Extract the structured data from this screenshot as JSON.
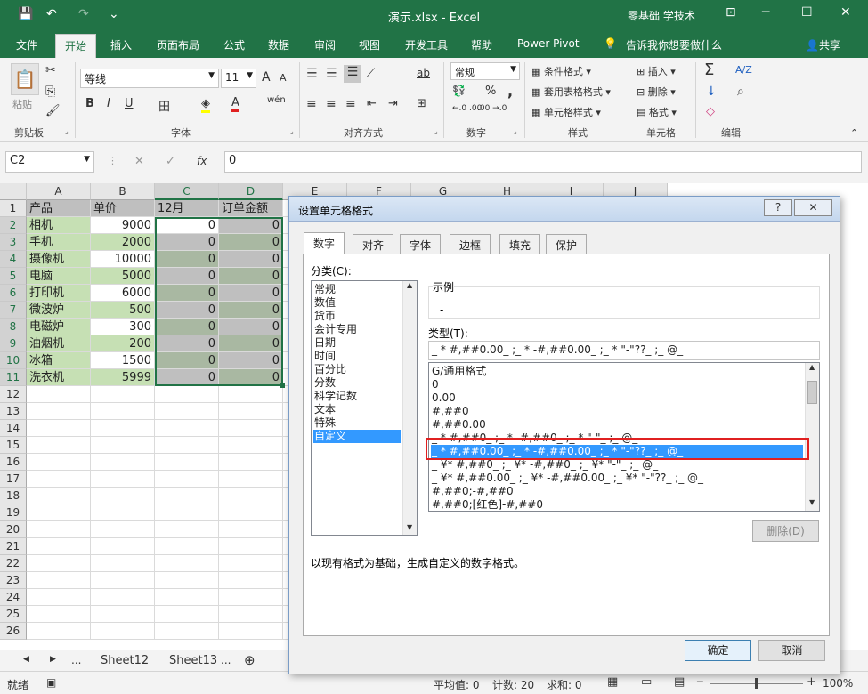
{
  "window": {
    "title": "演示.xlsx  -  Excel",
    "user": "零基础 学技术",
    "quick_access": {
      "save": "💾",
      "undo": "↶",
      "redo": "↷",
      "more": "⌄"
    },
    "controls": {
      "minimize": "─",
      "maximize": "☐",
      "close": "✕",
      "ribbon_options": "⊡"
    }
  },
  "menu": {
    "tabs": [
      "文件",
      "开始",
      "插入",
      "页面布局",
      "公式",
      "数据",
      "审阅",
      "视图",
      "开发工具",
      "帮助",
      "Power Pivot"
    ],
    "active_index": 1,
    "tell_me": "告诉我你想要做什么",
    "share": "共享"
  },
  "ribbon": {
    "clipboard": {
      "label": "剪贴板",
      "paste": "粘贴",
      "cut": "✂",
      "copy": "⎘",
      "brush": "🖌"
    },
    "font": {
      "label": "字体",
      "name": "等线",
      "size": "11",
      "grow": "A",
      "shrink": "A",
      "bold": "B",
      "italic": "I",
      "underline": "U",
      "border": "田",
      "fill": "◈",
      "color": "A",
      "phonetic": "wén"
    },
    "alignment": {
      "label": "对齐方式",
      "wrap": "ab",
      "orient": "⟋"
    },
    "number": {
      "label": "数字",
      "format": "常规",
      "currency": "💱",
      "percent": "%",
      "comma": ",",
      "inc": "←.0 .00",
      "dec": ".00 →.0"
    },
    "styles": {
      "label": "样式",
      "conditional": "条件格式",
      "table": "套用表格格式",
      "cell": "单元格样式"
    },
    "cells": {
      "label": "单元格",
      "insert": "插入",
      "delete": "删除",
      "format": "格式"
    },
    "editing": {
      "label": "编辑",
      "sum": "Σ",
      "sort": "A/Z",
      "fill": "↓",
      "find": "⌕",
      "clear": "◇"
    }
  },
  "formula_bar": {
    "name_box": "C2",
    "fx": "fx",
    "cancel": "✕",
    "confirm": "✓",
    "value": "0"
  },
  "sheet": {
    "columns": [
      "A",
      "B",
      "C",
      "D",
      "E",
      "F",
      "G",
      "H",
      "I",
      "J"
    ],
    "rows": [
      "1",
      "2",
      "3",
      "4",
      "5",
      "6",
      "7",
      "8",
      "9",
      "10",
      "11",
      "12",
      "13",
      "14",
      "15",
      "16",
      "17",
      "18",
      "19",
      "20",
      "21",
      "22",
      "23",
      "24",
      "25",
      "26"
    ],
    "header": [
      "产品",
      "单价",
      "12月",
      "订单金额"
    ],
    "data": [
      [
        "相机",
        "9000",
        "0",
        "0"
      ],
      [
        "手机",
        "2000",
        "0",
        "0"
      ],
      [
        "摄像机",
        "10000",
        "0",
        "0"
      ],
      [
        "电脑",
        "5000",
        "0",
        "0"
      ],
      [
        "打印机",
        "6000",
        "0",
        "0"
      ],
      [
        "微波炉",
        "500",
        "0",
        "0"
      ],
      [
        "电磁炉",
        "300",
        "0",
        "0"
      ],
      [
        "油烟机",
        "200",
        "0",
        "0"
      ],
      [
        "冰箱",
        "1500",
        "0",
        "0"
      ],
      [
        "洗衣机",
        "5999",
        "0",
        "0"
      ]
    ]
  },
  "sheet_tabs": {
    "items": [
      "...",
      "Sheet12",
      "Sheet13",
      "..."
    ],
    "add": "⊕",
    "nav_prev": "◀",
    "nav_next": "▶"
  },
  "status": {
    "ready": "就绪",
    "average": "平均值: 0",
    "count": "计数: 20",
    "sum": "求和: 0",
    "zoom": "100%",
    "zoom_out": "─",
    "zoom_in": "+"
  },
  "dialog": {
    "title": "设置单元格格式",
    "help": "?",
    "close": "✕",
    "tabs": [
      "数字",
      "对齐",
      "字体",
      "边框",
      "填充",
      "保护"
    ],
    "category_label": "分类(C):",
    "categories": [
      "常规",
      "数值",
      "货币",
      "会计专用",
      "日期",
      "时间",
      "百分比",
      "分数",
      "科学记数",
      "文本",
      "特殊",
      "自定义"
    ],
    "selected_category": "自定义",
    "sample_label": "示例",
    "sample_value": "-",
    "type_label": "类型(T):",
    "type_value": "_ * #,##0.00_ ;_ * -#,##0.00_ ;_ * \"-\"??_ ;_ @_",
    "formats": [
      "G/通用格式",
      "0",
      "0.00",
      "#,##0",
      "#,##0.00",
      "_ * #,##0_ ;_ * -#,##0_ ;_ * \"-\"_ ;_ @_",
      "_ * #,##0.00_ ;_ * -#,##0.00_ ;_ * \"-\"??_ ;_ @_",
      "_ ¥* #,##0_ ;_ ¥* -#,##0_ ;_ ¥* \"-\"_ ;_ @_",
      "_ ¥* #,##0.00_ ;_ ¥* -#,##0.00_ ;_ ¥* \"-\"??_ ;_ @_",
      "#,##0;-#,##0",
      "#,##0;[红色]-#,##0"
    ],
    "selected_format_index": 6,
    "delete_button": "删除(D)",
    "description": "以现有格式为基础，生成自定义的数字格式。",
    "ok": "确定",
    "cancel": "取消"
  },
  "colors": {
    "excel_green": "#217346",
    "selection_blue": "#3399ff",
    "highlight_red": "#e02020",
    "green_fill": "#c6e0b4",
    "grey_fill": "#bfbfbf",
    "dark_fill": "#a9b8a2"
  }
}
